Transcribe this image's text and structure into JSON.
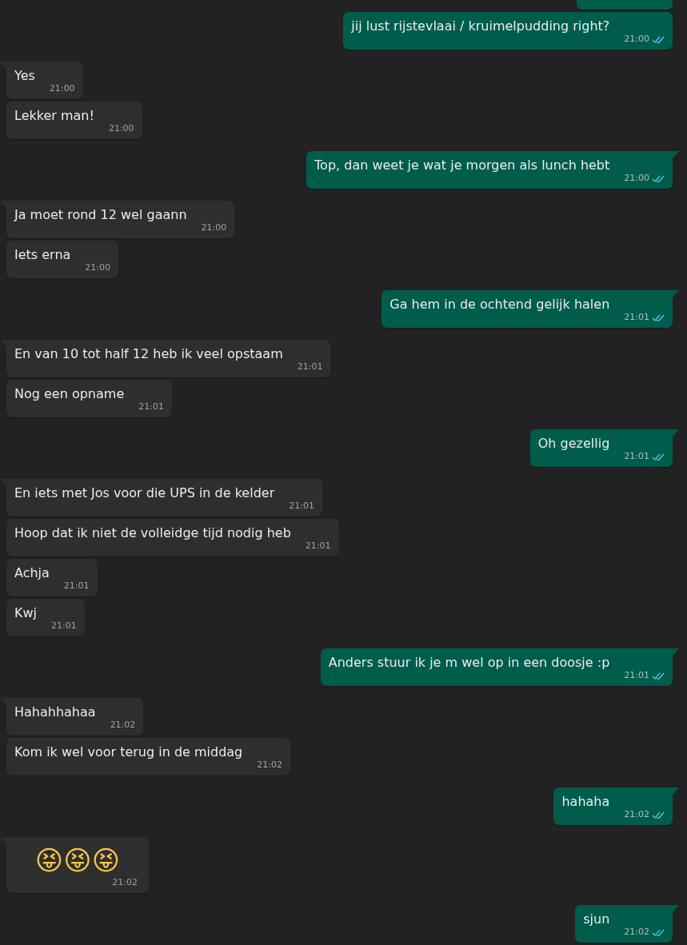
{
  "messages": [
    {
      "outgoing": true,
      "kind": "clipped"
    },
    {
      "outgoing": true,
      "kind": "text",
      "text": "jij lust rijstevlaai / kruimelpudding right?",
      "time": "21:00",
      "read": true
    },
    {
      "outgoing": false,
      "kind": "text",
      "text": "Yes",
      "time": "21:00"
    },
    {
      "outgoing": false,
      "kind": "text",
      "text": "Lekker man!",
      "time": "21:00"
    },
    {
      "outgoing": true,
      "kind": "text",
      "text": "Top, dan weet je wat je morgen als lunch hebt",
      "time": "21:00",
      "read": true
    },
    {
      "outgoing": false,
      "kind": "text",
      "text": "Ja moet rond 12 wel gaann",
      "time": "21:00"
    },
    {
      "outgoing": false,
      "kind": "text",
      "text": "Iets erna",
      "time": "21:00"
    },
    {
      "outgoing": true,
      "kind": "text",
      "text": "Ga hem in de ochtend gelijk halen",
      "time": "21:01",
      "read": true
    },
    {
      "outgoing": false,
      "kind": "text",
      "text": "En van 10 tot half 12 heb ik veel opstaam",
      "time": "21:01"
    },
    {
      "outgoing": false,
      "kind": "text",
      "text": "Nog een opname",
      "time": "21:01"
    },
    {
      "outgoing": true,
      "kind": "text",
      "text": "Oh gezellig",
      "time": "21:01",
      "read": true
    },
    {
      "outgoing": false,
      "kind": "text",
      "text": "En iets met Jos voor die UPS in de kelder",
      "time": "21:01"
    },
    {
      "outgoing": false,
      "kind": "text",
      "text": "Hoop dat ik niet de volleidge tijd nodig heb",
      "time": "21:01"
    },
    {
      "outgoing": false,
      "kind": "text",
      "text": "Achja",
      "time": "21:01"
    },
    {
      "outgoing": false,
      "kind": "text",
      "text": "Kwj",
      "time": "21:01"
    },
    {
      "outgoing": true,
      "kind": "text",
      "text": "Anders stuur ik je m wel op in een doosje :p",
      "time": "21:01",
      "read": true
    },
    {
      "outgoing": false,
      "kind": "text",
      "text": "Hahahhahaa",
      "time": "21:02"
    },
    {
      "outgoing": false,
      "kind": "text",
      "text": "Kom ik wel voor terug in de middag",
      "time": "21:02"
    },
    {
      "outgoing": true,
      "kind": "text",
      "text": "hahaha",
      "time": "21:02",
      "read": true
    },
    {
      "outgoing": false,
      "kind": "emoji",
      "text": "😝😝😝",
      "time": "21:02"
    },
    {
      "outgoing": true,
      "kind": "text",
      "text": "sjun",
      "time": "21:02",
      "read": true
    }
  ]
}
